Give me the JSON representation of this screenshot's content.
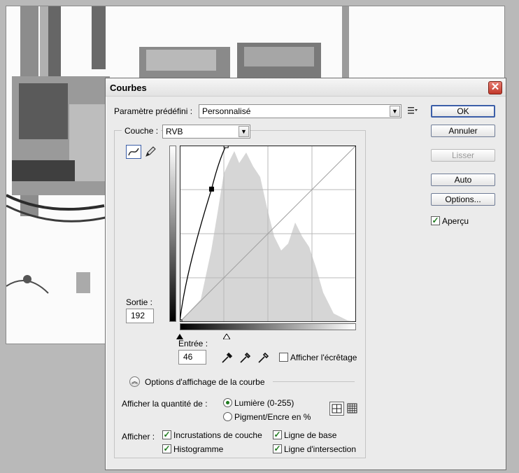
{
  "dialog": {
    "title": "Courbes",
    "close_glyph": "✕",
    "preset_label": "Paramètre prédéfini :",
    "preset_value": "Personnalisé",
    "channel_label": "Couche :",
    "channel_value": "RVB",
    "output_label": "Sortie :",
    "output_value": "192",
    "input_label": "Entrée :",
    "input_value": "46",
    "show_clipping_label": "Afficher l'écrêtage",
    "curve_options_label": "Options d'affichage de la courbe",
    "show_amount_label": "Afficher la quantité de :",
    "light_label": "Lumière (0-255)",
    "pigment_label": "Pigment/Encre en %",
    "show_label": "Afficher :",
    "channel_overlays_label": "Incrustations de couche",
    "baseline_label": "Ligne de base",
    "histogram_label": "Histogramme",
    "intersection_label": "Ligne d'intersection",
    "preview_label": "Aperçu"
  },
  "buttons": {
    "ok": "OK",
    "cancel": "Annuler",
    "smooth": "Lisser",
    "auto": "Auto",
    "options": "Options..."
  },
  "state": {
    "light_selected": true,
    "show_clipping": false,
    "channel_overlays": true,
    "baseline": true,
    "histogram": true,
    "intersection": true,
    "preview": true
  },
  "curve": {
    "points": [
      [
        0,
        0
      ],
      [
        46,
        192
      ],
      [
        67,
        255
      ]
    ]
  },
  "icons": {
    "curve_tool": "curve-point-icon",
    "pencil_tool": "pencil-icon",
    "preset_menu": "list-menu-icon",
    "eyedroppers": [
      "black-eyedropper-icon",
      "gray-eyedropper-icon",
      "white-eyedropper-icon"
    ],
    "expand": "collapse-chevron-icon",
    "grid_simple": "grid-4x4-icon",
    "grid_detailed": "grid-10x10-icon"
  },
  "colors": {
    "histogram": "#d6d6d6",
    "accent_border": "#3b5ea8",
    "check": "#1d7a1d"
  }
}
